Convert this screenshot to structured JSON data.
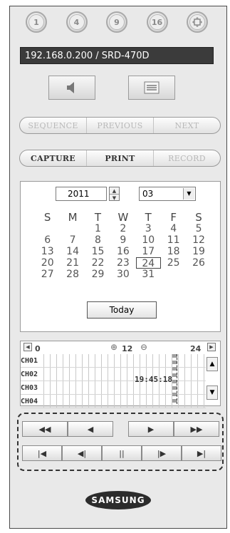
{
  "view_split": {
    "buttons": [
      "1",
      "4",
      "9",
      "16"
    ]
  },
  "connection": {
    "address": "192.168.0.200   / SRD-470D"
  },
  "icons": {
    "audio": "speaker-icon",
    "menu": "menu-icon",
    "fullscreen": "fullscreen-icon"
  },
  "nav_buttons": {
    "sequence": "SEQUENCE",
    "previous": "PREVIOUS",
    "next": "NEXT"
  },
  "action_buttons": {
    "capture": "CAPTURE",
    "print": "PRINT",
    "record": "RECORD"
  },
  "calendar": {
    "year": "2011",
    "month": "03",
    "weekdays": [
      "S",
      "M",
      "T",
      "W",
      "T",
      "F",
      "S"
    ],
    "weeks": [
      [
        "",
        "",
        "1",
        "2",
        "3",
        "4",
        "5"
      ],
      [
        "6",
        "7",
        "8",
        "9",
        "10",
        "11",
        "12"
      ],
      [
        "13",
        "14",
        "15",
        "16",
        "17",
        "18",
        "19"
      ],
      [
        "20",
        "21",
        "22",
        "23",
        "24",
        "25",
        "26"
      ],
      [
        "27",
        "28",
        "29",
        "30",
        "31",
        "",
        ""
      ]
    ],
    "selected_day": "24",
    "today_label": "Today"
  },
  "timeline": {
    "start": "0",
    "middle": "12",
    "end": "24",
    "channels": [
      "CH01",
      "CH02",
      "CH03",
      "CH04"
    ],
    "current_time": "19:45:18"
  },
  "brand": {
    "logo": "SAMSUNG"
  }
}
